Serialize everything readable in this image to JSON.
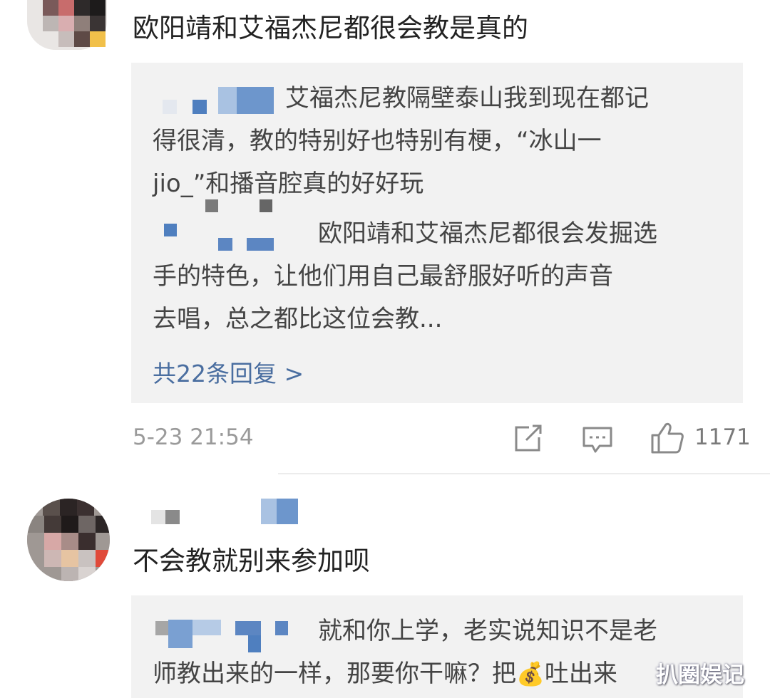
{
  "comments": [
    {
      "text": "欧阳靖和艾福杰尼都很会教是真的",
      "replies": [
        {
          "lines": [
            "艾福杰尼教隔壁泰山我到现在都记",
            "得很清，教的特别好也特别有梗，“冰山一",
            "jio_”和播音腔真的好好玩"
          ]
        },
        {
          "lines": [
            "欧阳靖和艾福杰尼都很会发掘选",
            "手的特色，让他们用自己最舒服好听的声音",
            "去唱，总之都比这位会教..."
          ]
        }
      ],
      "more_replies": "共22条回复 >",
      "timestamp": "5-23 21:54",
      "like_count": "1171"
    },
    {
      "text": "不会教就别来参加呗",
      "replies": [
        {
          "lines": [
            "就和你上学，老实说知识不是老",
            "师教出来的一样，那要你干嘛？把",
            "吐出来"
          ],
          "emoji": "💰"
        }
      ]
    }
  ],
  "icons": {
    "share": "share-icon",
    "comment": "comment-icon",
    "like": "thumbs-up-icon"
  },
  "watermark": "扒圈娱记",
  "colors": {
    "reply_bg": "#f2f2f2",
    "link": "#4a6ea0",
    "meta": "#9a9a9a",
    "mosaic_blue": "#4f7fbf"
  }
}
